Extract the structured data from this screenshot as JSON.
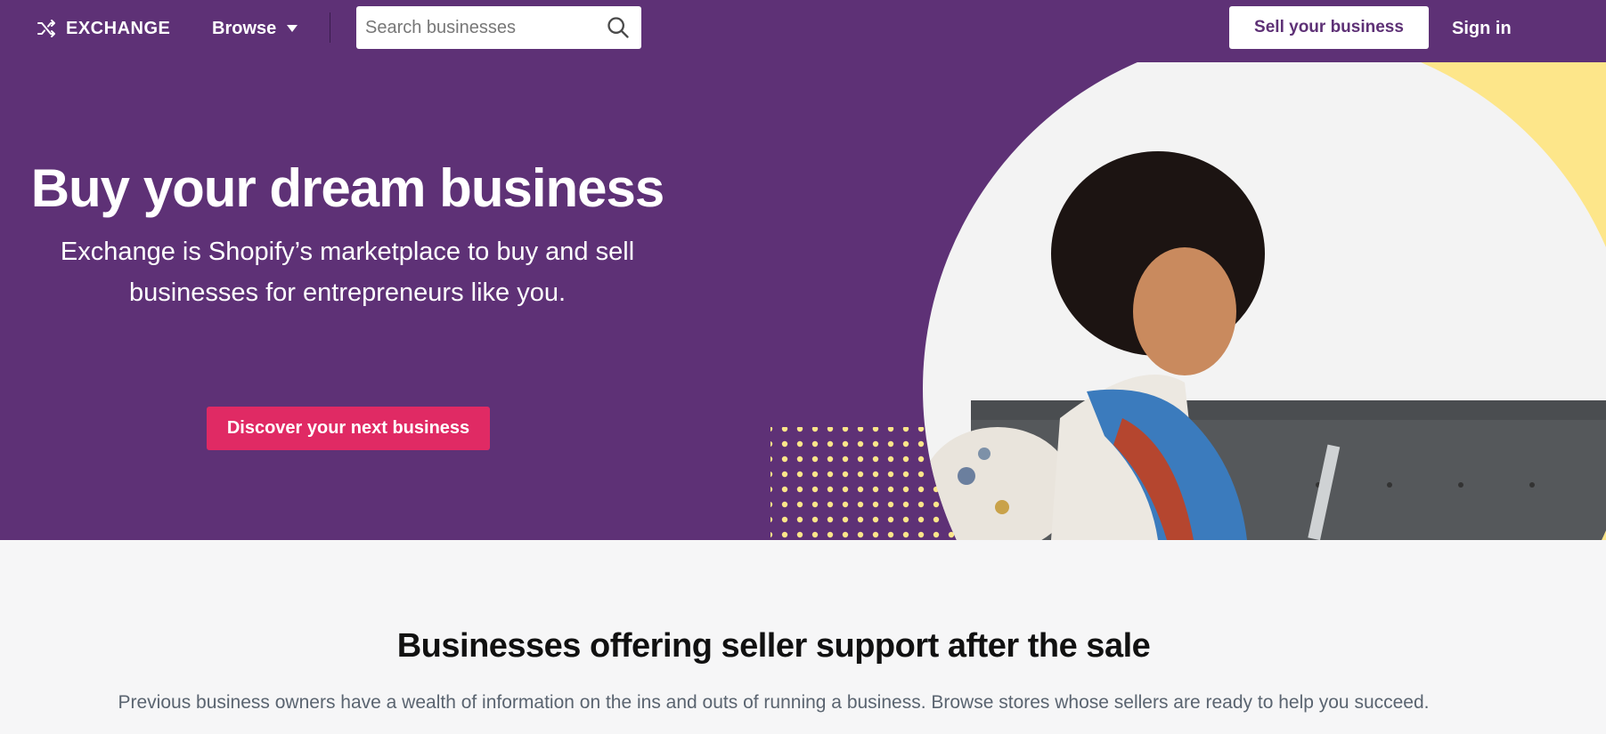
{
  "nav": {
    "logo": "EXCHANGE",
    "browse": "Browse",
    "search_placeholder": "Search businesses",
    "sell": "Sell your business",
    "signin": "Sign in"
  },
  "hero": {
    "title": "Buy your dream business",
    "subtitle_line1": "Exchange is Shopify’s marketplace to buy and sell",
    "subtitle_line2": "businesses for entrepreneurs like you.",
    "cta": "Discover your next business"
  },
  "section": {
    "title": "Businesses offering seller support after the sale",
    "description": "Previous business owners have a wealth of information on the ins and outs of running a business. Browse stores whose sellers are ready to help you succeed."
  },
  "colors": {
    "brand_purple": "#5e3176",
    "cta_pink": "#e02a64",
    "accent_yellow": "#fde68a"
  }
}
